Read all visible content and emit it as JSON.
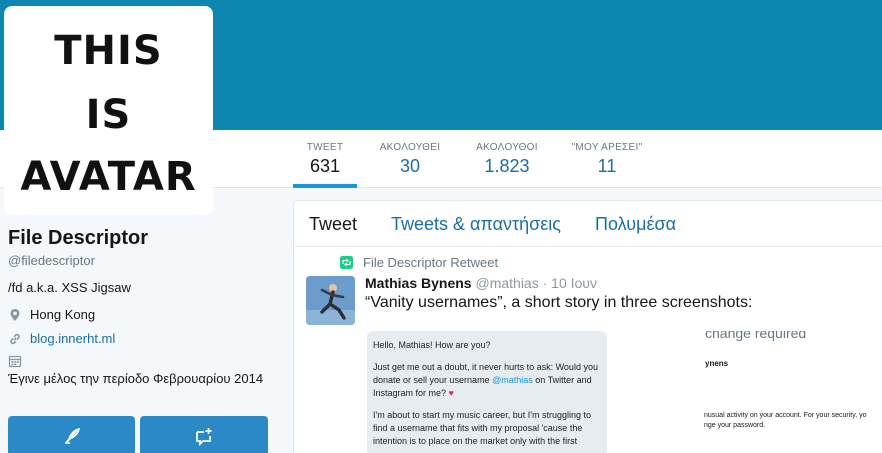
{
  "avatar": {
    "lines": [
      "THIS",
      "IS",
      "AVATAR"
    ]
  },
  "stats": [
    {
      "label": "TWEET",
      "value": "631"
    },
    {
      "label": "ΑΚΟΛΟΥΘΕΙ",
      "value": "30"
    },
    {
      "label": "ΑΚΟΛΟΥΘΟΙ",
      "value": "1.823"
    },
    {
      "label": "\"ΜΟΥ ΑΡΕΣΕΙ\"",
      "value": "11"
    }
  ],
  "profile": {
    "name": "File Descriptor",
    "handle": "@filedescriptor",
    "bio": "/fd a.k.a. XSS Jigsaw",
    "location": "Hong Kong",
    "website": "blog.innerht.ml",
    "joined": "Έγινε μέλος την περίοδο Φεβρουαρίου 2014"
  },
  "tabs": [
    "Tweet",
    "Tweets & απαντήσεις",
    "Πολυμέσα"
  ],
  "tweet": {
    "retweet_label": "File Descriptor Retweet",
    "author_name": "Mathias Bynens",
    "author_handle": "@mathias",
    "date": "10 Ιουν",
    "text": "“Vanity usernames”, a short story in three screenshots:",
    "screenshot1": {
      "greeting": "Hello, Mathias! How are you?",
      "p2_before": "Just get me out a doubt, it never hurts to ask: Would you donate or sell your username ",
      "p2_mention": "@mathias",
      "p2_after": " on Twitter and Instagram for me?",
      "p3": "I'm about to start my music career, but I'm struggling to find a username that fits with my proposal 'cause the intention is to place on the market only with the first"
    },
    "screenshot2": {
      "title": "change required",
      "name": "ynens",
      "line1": "nusual activity on your account. For your security, yo",
      "line2": "nge your password."
    }
  },
  "colors": {
    "banner": "#0d86b0",
    "link": "#1b6ea1",
    "button": "#2b8ac6",
    "active_tab_bar": "#1b95e0"
  }
}
